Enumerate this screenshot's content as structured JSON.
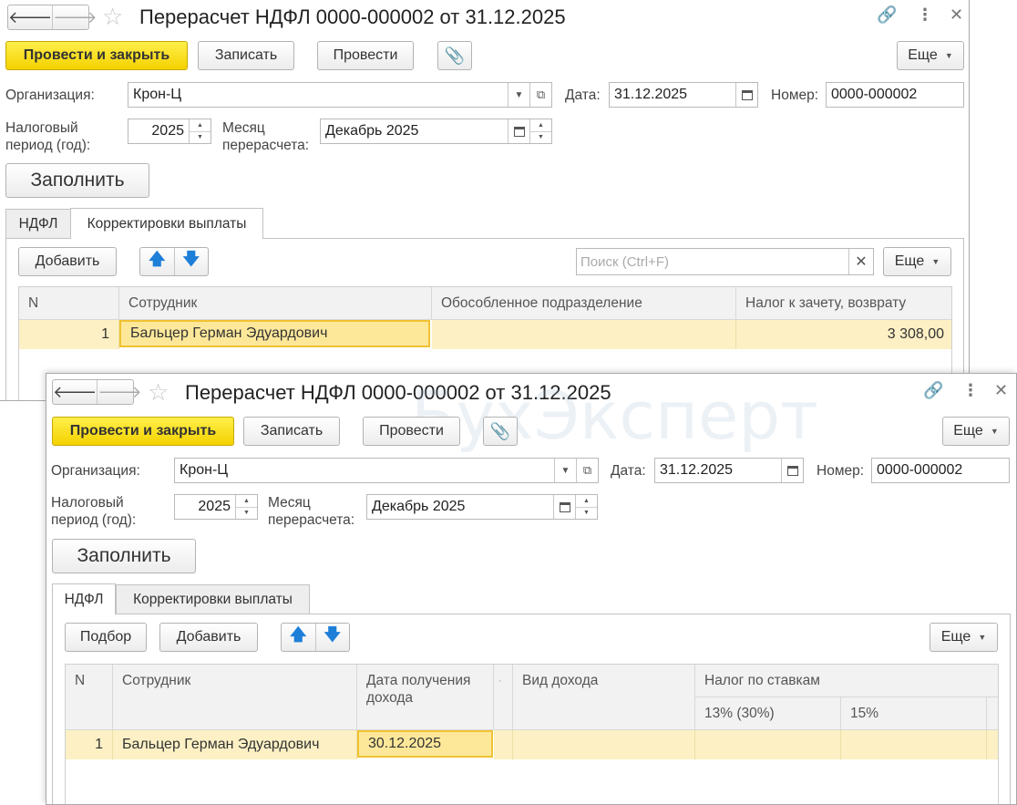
{
  "back_window": {
    "title": "Перерасчет НДФЛ 0000-000002 от 31.12.2025",
    "toolbar": {
      "post_close": "Провести и закрыть",
      "save": "Записать",
      "post": "Провести",
      "more": "Еще"
    },
    "org_label": "Организация:",
    "org_value": "Крон-Ц",
    "date_label": "Дата:",
    "date_value": "31.12.2025",
    "number_label": "Номер:",
    "number_value": "0000-000002",
    "period_label": "Налоговый период (год):",
    "period_value": "2025",
    "month_label": "Месяц перерасчета:",
    "month_value": "Декабрь 2025",
    "fill": "Заполнить",
    "tabs": [
      "НДФЛ",
      "Корректировки выплаты"
    ],
    "panel_toolbar": {
      "add": "Добавить",
      "search_placeholder": "Поиск (Ctrl+F)",
      "more": "Еще"
    },
    "columns": [
      "N",
      "Сотрудник",
      "Обособленное подразделение",
      "Налог к зачету, возврату"
    ],
    "rows": [
      {
        "n": "1",
        "employee": "Бальцер Герман Эдуардович",
        "division": "",
        "tax": "3 308,00"
      }
    ]
  },
  "front_window": {
    "title": "Перерасчет НДФЛ 0000-000002 от 31.12.2025",
    "toolbar": {
      "post_close": "Провести и закрыть",
      "save": "Записать",
      "post": "Провести",
      "more": "Еще"
    },
    "org_label": "Организация:",
    "org_value": "Крон-Ц",
    "date_label": "Дата:",
    "date_value": "31.12.2025",
    "number_label": "Номер:",
    "number_value": "0000-000002",
    "period_label": "Налоговый период (год):",
    "period_value": "2025",
    "month_label": "Месяц перерасчета:",
    "month_value": "Декабрь 2025",
    "fill": "Заполнить",
    "tabs": [
      "НДФЛ",
      "Корректировки выплаты"
    ],
    "panel_toolbar": {
      "pick": "Подбор",
      "add": "Добавить",
      "more": "Еще"
    },
    "columns": {
      "n": "N",
      "employee": "Сотрудник",
      "income_date": "Дата получения дохода",
      "income_type": "Вид дохода",
      "tax_by_rate": "Налог по ставкам",
      "rate_13": "13% (30%)",
      "rate_15": "15%"
    },
    "rows": [
      {
        "n": "1",
        "employee": "Бальцер Герман Эдуардович",
        "income_date": "30.12.2025"
      }
    ]
  },
  "watermark": "БухЭксперт"
}
